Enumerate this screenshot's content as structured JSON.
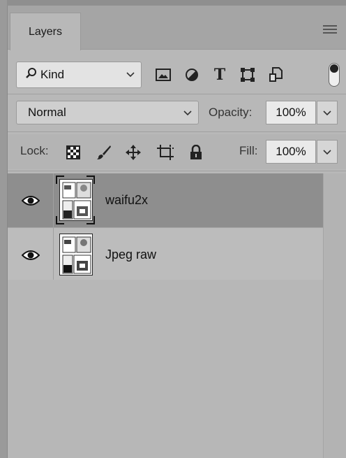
{
  "panel": {
    "tab_label": "Layers",
    "menu_icon": "panel-menu-icon"
  },
  "filter": {
    "kind_label": "Kind",
    "icons": [
      "image-filter-icon",
      "adjustment-filter-icon",
      "type-filter-icon",
      "shape-filter-icon",
      "smart-object-filter-icon"
    ],
    "type_glyph": "T",
    "toggle_icon": "filter-toggle-icon"
  },
  "blend": {
    "mode": "Normal",
    "opacity_label": "Opacity:",
    "opacity_value": "100%"
  },
  "lock": {
    "label": "Lock:",
    "icons": [
      "lock-transparent-pixels-icon",
      "lock-image-pixels-icon",
      "lock-position-icon",
      "lock-artboard-icon",
      "lock-all-icon"
    ],
    "fill_label": "Fill:",
    "fill_value": "100%"
  },
  "layers": [
    {
      "name": "waifu2x",
      "visible": true,
      "selected": true
    },
    {
      "name": "Jpeg raw",
      "visible": true,
      "selected": false
    }
  ],
  "colors": {
    "panel_bg": "#b8b8b8",
    "selected_layer": "#8e8e8e",
    "normal_layer": "#bcbcbc"
  }
}
